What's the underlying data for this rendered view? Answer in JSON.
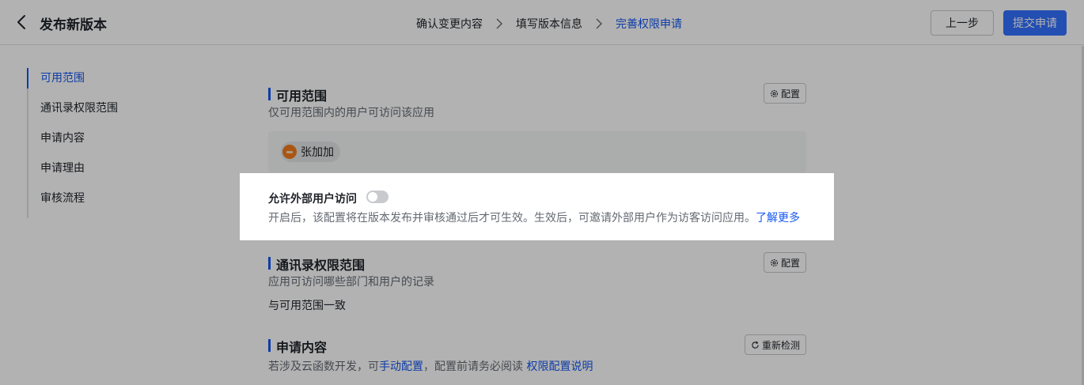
{
  "header": {
    "title": "发布新版本",
    "steps": [
      "确认变更内容",
      "填写版本信息",
      "完善权限申请"
    ],
    "active_step": 2,
    "prev_label": "上一步",
    "submit_label": "提交申请"
  },
  "nav": {
    "items": [
      "可用范围",
      "通讯录权限范围",
      "申请内容",
      "申请理由",
      "审核流程"
    ],
    "active_index": 0
  },
  "availability": {
    "title": "可用范围",
    "desc": "仅可用范围内的用户可访问该应用",
    "config_label": "配置",
    "member": "张加加"
  },
  "external": {
    "label": "允许外部用户访问",
    "enabled": false,
    "desc": "开启后，该配置将在版本发布并审核通过后才可生效。生效后，可邀请外部用户作为访客访问应用。",
    "learn_more": "了解更多"
  },
  "contacts": {
    "title": "通讯录权限范围",
    "desc": "应用可访问哪些部门和用户的记录",
    "config_label": "配置",
    "value": "与可用范围一致"
  },
  "request": {
    "title": "申请内容",
    "recheck_label": "重新检测",
    "desc_prefix": "若涉及云函数开发，可",
    "manual_link": "手动配置",
    "desc_middle": "，配置前请务必阅读",
    "doc_link": "权限配置说明"
  },
  "colors": {
    "accent": "#1456f0",
    "primary_button": "#3370ff"
  }
}
